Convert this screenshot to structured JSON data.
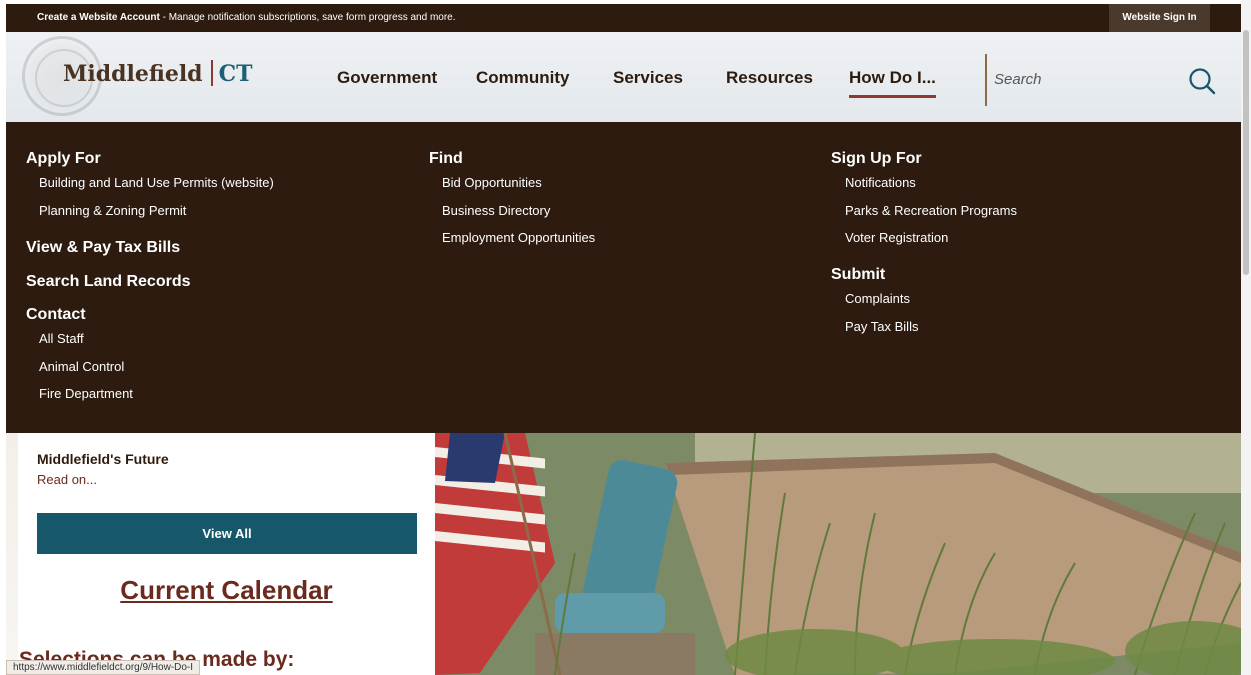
{
  "topbar": {
    "message_bold": "Create a Website Account",
    "message_rest": " - Manage notification subscriptions, save form progress and more.",
    "signin_label": "Website Sign In"
  },
  "header": {
    "logo_name": "Middlefield",
    "logo_state": "CT",
    "nav": [
      "Government",
      "Community",
      "Services",
      "Resources",
      "How Do I..."
    ],
    "active_nav": "How Do I...",
    "search_placeholder": "Search"
  },
  "mega_menu": {
    "apply_for": {
      "heading": "Apply For",
      "links": [
        "Building and Land Use Permits (website)",
        "Planning & Zoning Permit"
      ]
    },
    "view_pay": "View & Pay Tax Bills",
    "search_land": "Search Land Records",
    "contact": {
      "heading": "Contact",
      "links": [
        "All Staff",
        "Animal Control",
        "Fire Department"
      ]
    },
    "find": {
      "heading": "Find",
      "links": [
        "Bid Opportunities",
        "Business Directory",
        "Employment Opportunities"
      ]
    },
    "sign_up_for": {
      "heading": "Sign Up For",
      "links": [
        "Notifications",
        "Parks & Recreation Programs",
        "Voter Registration"
      ]
    },
    "submit": {
      "heading": "Submit",
      "links": [
        "Complaints",
        "Pay Tax Bills"
      ]
    }
  },
  "content": {
    "news_title": "Middlefield's Future",
    "read_on": "Read on...",
    "view_all": "View All",
    "calendar_link": "Current Calendar",
    "selections_text": "Selections can be made by:"
  },
  "status_url": "https://www.middlefieldct.org/9/How-Do-I",
  "colors": {
    "dark_brown": "#2c1b0e",
    "accent_red": "#8b3a2f",
    "teal": "#17576a"
  }
}
